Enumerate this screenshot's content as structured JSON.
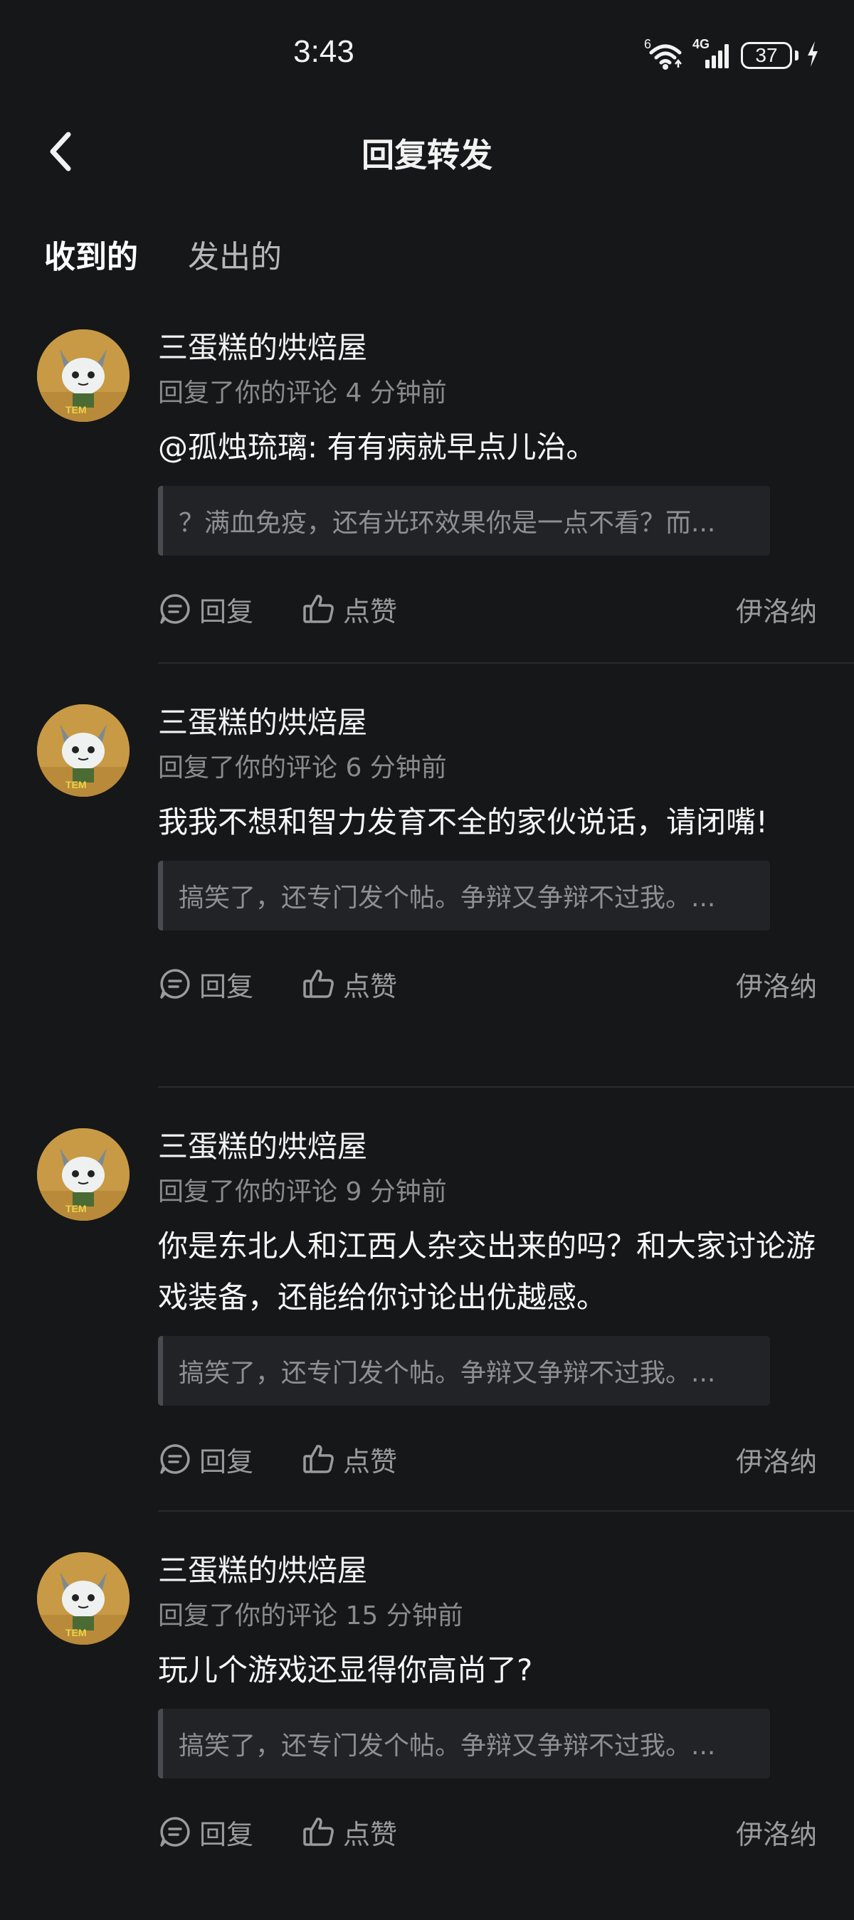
{
  "status_bar": {
    "time": "3:43",
    "wifi_label": "6",
    "network_label": "4G",
    "battery_level": "37"
  },
  "header": {
    "title": "回复转发"
  },
  "tabs": [
    {
      "label": "收到的",
      "active": true
    },
    {
      "label": "发出的",
      "active": false
    }
  ],
  "colors": {
    "accent": "#1ec8ad",
    "background": "#161718",
    "quote_background": "#222327"
  },
  "items": [
    {
      "author": "三蛋糕的烘焙屋",
      "meta": "回复了你的评论 4 分钟前",
      "text": "@孤烛琉璃: 有有病就早点儿治。",
      "quote": "？满血免疫，还有光环效果你是一点不看？而...",
      "reply_label": "回复",
      "like_label": "点赞",
      "source": "伊洛纳"
    },
    {
      "author": "三蛋糕的烘焙屋",
      "meta": "回复了你的评论 6 分钟前",
      "text": "我我不想和智力发育不全的家伙说话，请闭嘴!",
      "quote": "搞笑了，还专门发个帖。争辩又争辩不过我。...",
      "reply_label": "回复",
      "like_label": "点赞",
      "source": "伊洛纳"
    },
    {
      "author": "三蛋糕的烘焙屋",
      "meta": "回复了你的评论 9 分钟前",
      "text": "你是东北人和江西人杂交出来的吗？和大家讨论游戏装备，还能给你讨论出优越感。",
      "quote": "搞笑了，还专门发个帖。争辩又争辩不过我。...",
      "reply_label": "回复",
      "like_label": "点赞",
      "source": "伊洛纳"
    },
    {
      "author": "三蛋糕的烘焙屋",
      "meta": "回复了你的评论 15 分钟前",
      "text": "玩儿个游戏还显得你高尚了?",
      "quote": "搞笑了，还专门发个帖。争辩又争辩不过我。...",
      "reply_label": "回复",
      "like_label": "点赞",
      "source": "伊洛纳"
    }
  ]
}
